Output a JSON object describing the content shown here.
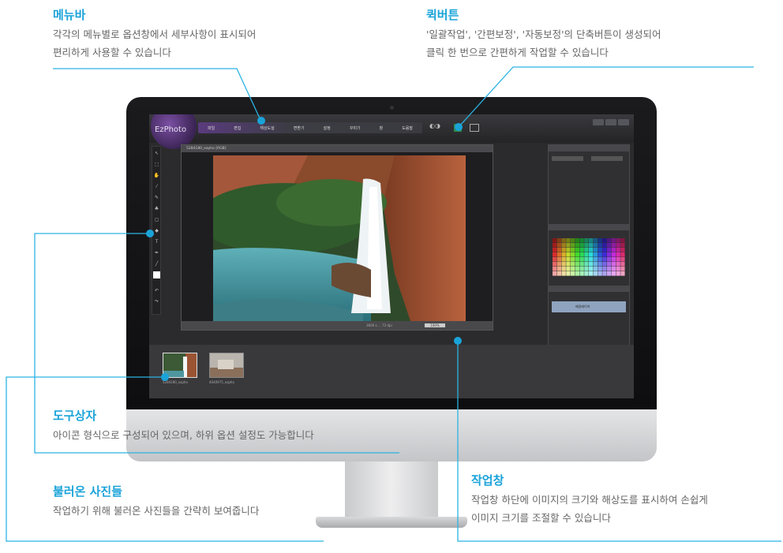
{
  "callouts": {
    "menubar": {
      "title": "메뉴바",
      "line1": "각각의 메뉴별로 옵션창에서 세부사항이 표시되어",
      "line2": "편리하게 사용할 수 있습니다"
    },
    "quickbutton": {
      "title": "퀵버튼",
      "line1": "'일괄작업', '간편보정', '자동보정'의 단축버튼이 생성되어",
      "line2": "클릭 한 번으로 간편하게 작업할 수 있습니다"
    },
    "toolbox": {
      "title": "도구상자",
      "line1": "아이콘 형식으로 구성되어 있으며, 하위 옵션 설정도 가능합니다"
    },
    "workwindow": {
      "title": "작업창",
      "line1": "작업창 하단에 이미지의 크기와 해상도를 표시하여 손쉽게",
      "line2": "이미지 크기를 조절할 수 있습니다"
    },
    "loadedphotos": {
      "title": "불러온 사진들",
      "line1": "작업하기 위해 불러온 사진들을 간략히 보여줍니다"
    }
  },
  "colors": {
    "accent": "#1aa3d9",
    "leader_line": "#2bb3e3"
  },
  "app": {
    "logo": "EzPhoto",
    "menu_items": [
      "파일",
      "편집",
      "해상도설",
      "변환기",
      "설정",
      "꾸미기",
      "창",
      "도움말"
    ],
    "document_title": "5284180_ezpho [RGB]",
    "status_text": "3600 x ... 72 dpi",
    "zoom_value": "100%",
    "thumbnails": [
      "5284180_ezpho",
      "4040975_ezpho"
    ],
    "layer_name": "배경레이어"
  }
}
